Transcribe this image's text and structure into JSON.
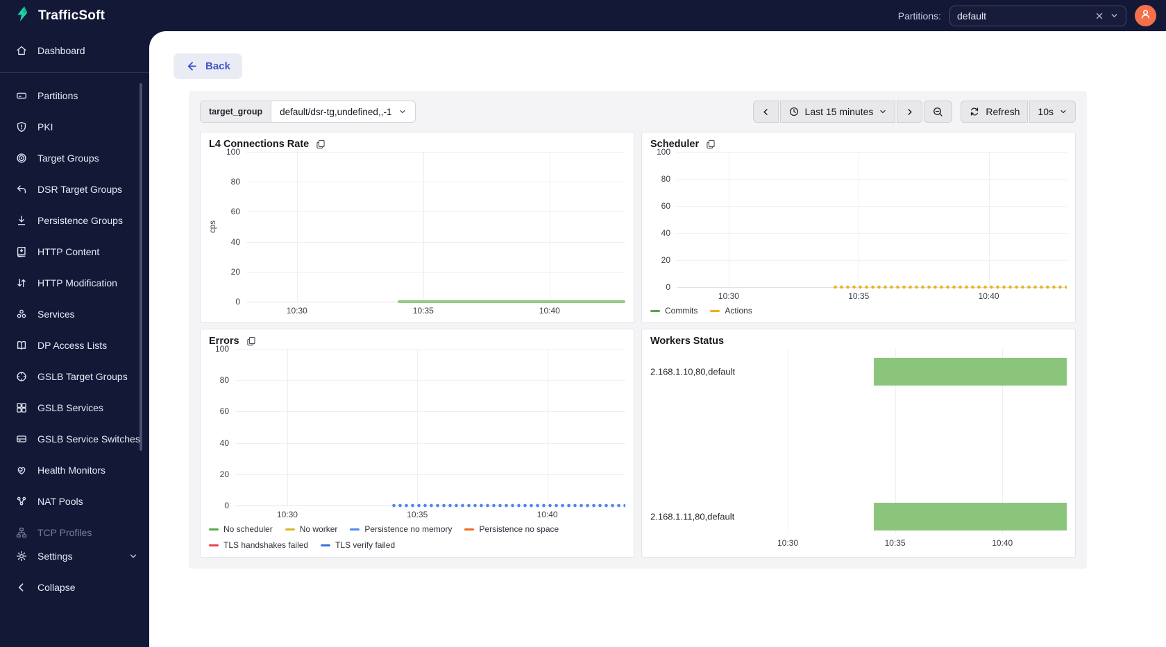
{
  "app": {
    "name": "TrafficSoft"
  },
  "header": {
    "partitions_label": "Partitions:",
    "partitions_value": "default"
  },
  "sidebar": {
    "items": [
      {
        "label": "Dashboard",
        "icon": "home"
      },
      {
        "label": "Partitions",
        "icon": "hard-drive"
      },
      {
        "label": "PKI",
        "icon": "shield-alert"
      },
      {
        "label": "Target Groups",
        "icon": "target"
      },
      {
        "label": "DSR Target Groups",
        "icon": "reply-arrow"
      },
      {
        "label": "Persistence Groups",
        "icon": "arrow-down-to-line"
      },
      {
        "label": "HTTP Content",
        "icon": "book-arrow-down"
      },
      {
        "label": "HTTP Modification",
        "icon": "arrows-up-down"
      },
      {
        "label": "Services",
        "icon": "node-cluster"
      },
      {
        "label": "DP Access Lists",
        "icon": "open-book"
      },
      {
        "label": "GSLB Target Groups",
        "icon": "circle-crosshair"
      },
      {
        "label": "GSLB Services",
        "icon": "grid"
      },
      {
        "label": "GSLB Service Switches",
        "icon": "switch-drive"
      },
      {
        "label": "Health Monitors",
        "icon": "heart-check"
      },
      {
        "label": "NAT Pools",
        "icon": "network-nodes"
      },
      {
        "label": "TCP Profiles",
        "icon": "sitemap",
        "disabled": true
      }
    ],
    "settings_label": "Settings",
    "collapse_label": "Collapse"
  },
  "toolbar": {
    "back_label": "Back",
    "filter_key": "target_group",
    "filter_value": "default/dsr-tg,undefined,,-1",
    "time_range_label": "Last 15 minutes",
    "refresh_label": "Refresh",
    "refresh_interval": "10s"
  },
  "colors": {
    "sidebar_bg": "#141837",
    "brand_teal": "#1ed3a6",
    "avatar_orange": "#f3704a",
    "back_accent": "#4355cb",
    "status_up_green": "#8bc57b"
  },
  "chart_data": [
    {
      "id": "l4_connections_rate",
      "type": "line",
      "title": "L4 Connections Rate",
      "ylabel": "cps",
      "ylim": [
        0,
        100
      ],
      "yticks": [
        100,
        80,
        60,
        40,
        20,
        0
      ],
      "xticks": [
        "10:30",
        "10:35",
        "10:40"
      ],
      "x_range": [
        "10:28",
        "10:43"
      ],
      "grid": true,
      "series": [
        {
          "name": "cps",
          "color": "#94ca83",
          "line_style": "solid",
          "in_legend": false,
          "data": {
            "x_start": "10:34",
            "x_end": "10:43",
            "value": 0
          }
        }
      ]
    },
    {
      "id": "scheduler",
      "type": "line",
      "title": "Scheduler",
      "ylim": [
        0,
        100
      ],
      "yticks": [
        100,
        80,
        60,
        40,
        20,
        0
      ],
      "xticks": [
        "10:30",
        "10:35",
        "10:40"
      ],
      "x_range": [
        "10:28",
        "10:43"
      ],
      "grid": true,
      "legend_position": "bottom",
      "series": [
        {
          "name": "Commits",
          "color": "#56a64b",
          "line_style": "solid",
          "in_legend": true,
          "data": null
        },
        {
          "name": "Actions",
          "color": "#eab319",
          "line_style": "dotted",
          "in_legend": true,
          "data": {
            "x_start": "10:34",
            "x_end": "10:43",
            "value": 0
          }
        }
      ]
    },
    {
      "id": "errors",
      "type": "line",
      "title": "Errors",
      "ylim": [
        0,
        100
      ],
      "yticks": [
        100,
        80,
        60,
        40,
        20,
        0
      ],
      "xticks": [
        "10:30",
        "10:35",
        "10:40"
      ],
      "x_range": [
        "10:28",
        "10:43"
      ],
      "grid": true,
      "legend_position": "bottom",
      "series": [
        {
          "name": "No scheduler",
          "color": "#56a64b",
          "line_style": "solid",
          "in_legend": true,
          "data": null
        },
        {
          "name": "No worker",
          "color": "#d9b520",
          "line_style": "solid",
          "in_legend": true,
          "data": null
        },
        {
          "name": "Persistence no memory",
          "color": "#4d87f2",
          "line_style": "dotted",
          "in_legend": true,
          "data": {
            "x_start": "10:34",
            "x_end": "10:43",
            "value": 0
          }
        },
        {
          "name": "Persistence no space",
          "color": "#f2681c",
          "line_style": "solid",
          "in_legend": true,
          "data": null
        },
        {
          "name": "TLS handshakes failed",
          "color": "#e8424a",
          "line_style": "solid",
          "in_legend": true,
          "data": null
        },
        {
          "name": "TLS verify failed",
          "color": "#3871dc",
          "line_style": "solid",
          "in_legend": true,
          "data": null
        }
      ]
    },
    {
      "id": "workers_status",
      "type": "status-timeline",
      "title": "Workers Status",
      "categories": [
        "2.168.1.10,80,default",
        "2.168.1.11,80,default"
      ],
      "xticks": [
        "10:30",
        "10:35",
        "10:40"
      ],
      "x_range": [
        "10:30",
        "10:43"
      ],
      "bars": [
        {
          "category": "2.168.1.10,80,default",
          "x_start": "10:34",
          "x_end": "10:43",
          "value": "up",
          "color": "#8bc57b"
        },
        {
          "category": "2.168.1.11,80,default",
          "x_start": "10:34",
          "x_end": "10:43",
          "value": "up",
          "color": "#8bc57b"
        }
      ]
    }
  ]
}
